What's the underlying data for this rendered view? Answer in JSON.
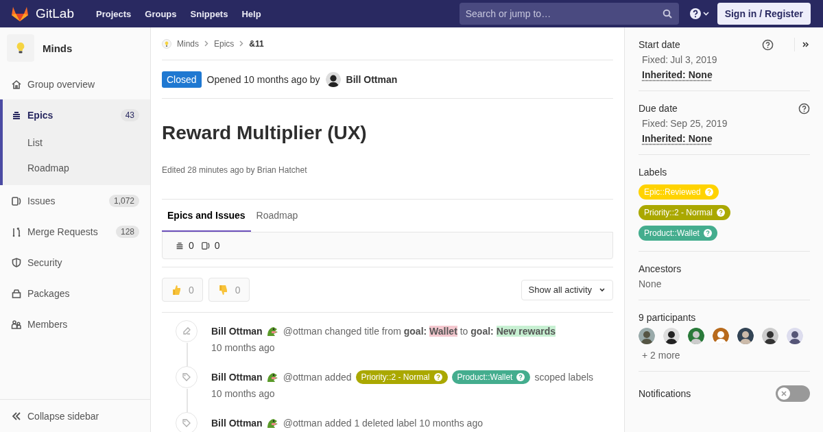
{
  "topbar": {
    "logo_text": "GitLab",
    "nav": [
      "Projects",
      "Groups",
      "Snippets",
      "Help"
    ],
    "search": {
      "placeholder": "Search or jump to…"
    },
    "sign_in": "Sign in / Register"
  },
  "sidebar": {
    "group_name": "Minds",
    "items": [
      {
        "label": "Group overview",
        "selected": false
      },
      {
        "label": "Epics",
        "count": "43",
        "selected": true,
        "children": [
          {
            "label": "List",
            "selected": false
          },
          {
            "label": "Roadmap",
            "selected": false
          }
        ]
      },
      {
        "label": "Issues",
        "count": "1,072",
        "selected": false
      },
      {
        "label": "Merge Requests",
        "count": "128",
        "selected": false
      },
      {
        "label": "Security",
        "selected": false
      },
      {
        "label": "Packages",
        "selected": false
      },
      {
        "label": "Members",
        "selected": false
      }
    ],
    "collapse": "Collapse sidebar"
  },
  "breadcrumb": [
    "Minds",
    "Epics",
    "&11"
  ],
  "header": {
    "status": "Closed",
    "opened": "Opened 10 months ago by",
    "author": "Bill Ottman"
  },
  "title": "Reward Multiplier (UX)",
  "edited": "Edited 28 minutes ago by Brian Hatchet",
  "tabs": [
    {
      "label": "Epics and Issues",
      "selected": true
    },
    {
      "label": "Roadmap",
      "selected": false
    }
  ],
  "counts": [
    "0",
    "0"
  ],
  "awards": [
    "0",
    "0"
  ],
  "activity_filter": "Show all activity",
  "activity": [
    {
      "kind": "title_change",
      "author": "Bill Ottman",
      "text": "@ottman changed title from",
      "from_prefix": "goal:",
      "from": "Wallet",
      "joiner": "to",
      "to_prefix": "goal:",
      "to": "New rewards",
      "time": "10 months ago"
    },
    {
      "kind": "labels",
      "author": "Bill Ottman",
      "text": "@ottman added",
      "labels": [
        {
          "name": "Priority::2 - Normal",
          "color": "#aaa800"
        },
        {
          "name": "Product::Wallet",
          "color": "#44ad8e"
        }
      ],
      "after": "scoped labels",
      "time": "10 months ago"
    },
    {
      "kind": "note",
      "author": "Bill Ottman",
      "text": "@ottman added 1 deleted label 10 months ago"
    }
  ],
  "right": {
    "start_date": {
      "label": "Start date",
      "fixed_label": "Fixed:",
      "fixed": "Jul 3, 2019",
      "inherited": "Inherited: None"
    },
    "due_date": {
      "label": "Due date",
      "fixed_label": "Fixed:",
      "fixed": "Sep 25, 2019",
      "inherited": "Inherited: None"
    },
    "labels_title": "Labels",
    "labels": [
      {
        "name": "Epic::Reviewed",
        "color": "#ffd300"
      },
      {
        "name": "Priority::2 - Normal",
        "color": "#aaa800"
      },
      {
        "name": "Product::Wallet",
        "color": "#44ad8e"
      }
    ],
    "ancestors": {
      "label": "Ancestors",
      "value": "None"
    },
    "participants": {
      "label": "9 participants",
      "more": "+ 2 more"
    },
    "notifications": {
      "label": "Notifications",
      "on": false
    }
  }
}
